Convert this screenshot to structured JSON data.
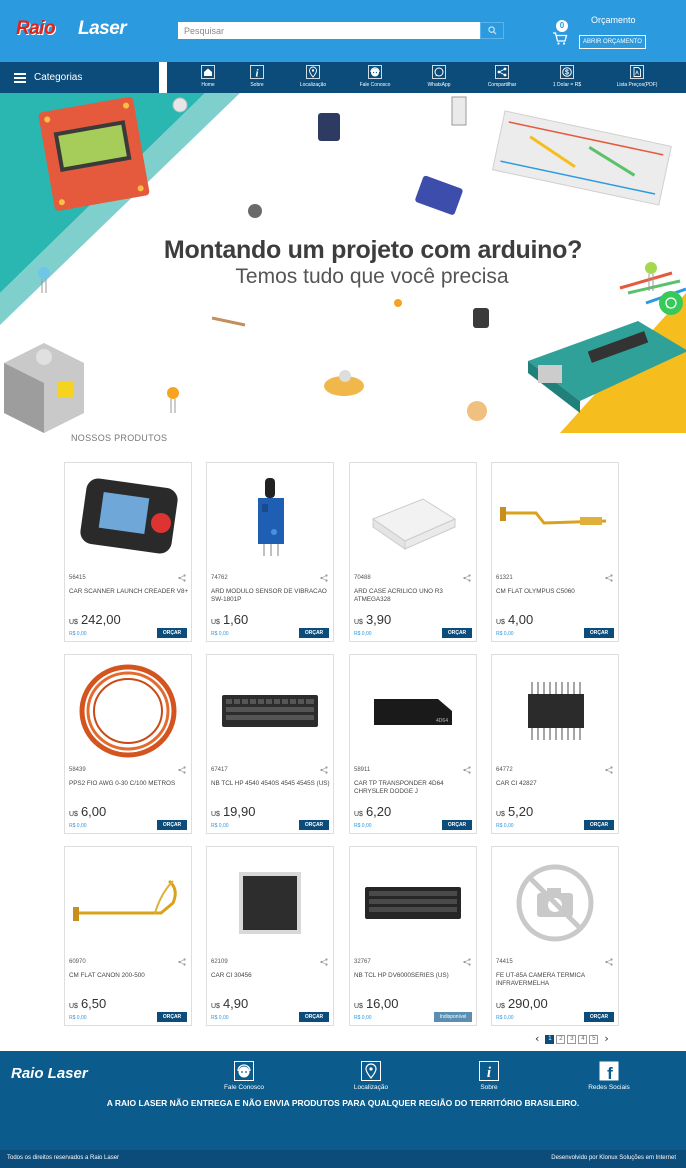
{
  "header": {
    "logo_word1": "Raio",
    "logo_word2": "Laser",
    "search_placeholder": "Pesquisar",
    "cart_count": "0",
    "quote_title": "Orçamento",
    "quote_button": "ABRIR ORÇAMENTO"
  },
  "nav": {
    "categories_label": "Categorias",
    "items": [
      {
        "label": "Home",
        "icon": "home-icon"
      },
      {
        "label": "Sobre",
        "icon": "info-icon"
      },
      {
        "label": "Localização",
        "icon": "location-icon"
      },
      {
        "label": "Fale Conosco",
        "icon": "support-icon"
      },
      {
        "label": "WhatsApp",
        "icon": "whatsapp-icon"
      },
      {
        "label": "Compartilhar",
        "icon": "share-icon"
      },
      {
        "label": "1 Dolar = R$",
        "icon": "dollar-icon"
      },
      {
        "label": "Lista Preços(PDF)",
        "icon": "pdf-icon"
      }
    ]
  },
  "banner": {
    "headline": "Montando um projeto com arduino?",
    "subheadline": "Temos tudo que você precisa"
  },
  "section_title": "NOSSOS PRODUTOS",
  "products": [
    {
      "code": "56415",
      "name": "CAR SCANNER LAUNCH CREADER V8+",
      "currency": "U$",
      "price": "242,00",
      "brl": "R$ 0,00",
      "button": "ORÇAR"
    },
    {
      "code": "74762",
      "name": "ARD MODULO SENSOR DE VIBRACAO SW-1801P",
      "currency": "U$",
      "price": "1,60",
      "brl": "R$ 0,00",
      "button": "ORÇAR"
    },
    {
      "code": "70488",
      "name": "ARD CASE ACRILICO UNO R3 ATMEGA328",
      "currency": "U$",
      "price": "3,90",
      "brl": "R$ 0,00",
      "button": "ORÇAR"
    },
    {
      "code": "61321",
      "name": "CM FLAT OLYMPUS C5060",
      "currency": "U$",
      "price": "4,00",
      "brl": "R$ 0,00",
      "button": "ORÇAR"
    },
    {
      "code": "58439",
      "name": "PPS2 FIO AWG 0-30 C/100 METROS",
      "currency": "U$",
      "price": "6,00",
      "brl": "R$ 0,00",
      "button": "ORÇAR"
    },
    {
      "code": "67417",
      "name": "NB TCL HP 4540 4540S 4545 4545S (US)",
      "currency": "U$",
      "price": "19,90",
      "brl": "R$ 0,00",
      "button": "ORÇAR"
    },
    {
      "code": "58911",
      "name": "CAR TP TRANSPONDER 4D64 CHRYSLER DODGE J",
      "currency": "U$",
      "price": "6,20",
      "brl": "R$ 0,00",
      "button": "ORÇAR"
    },
    {
      "code": "64772",
      "name": "CAR CI 42827",
      "currency": "U$",
      "price": "5,20",
      "brl": "R$ 0,00",
      "button": "ORÇAR"
    },
    {
      "code": "60970",
      "name": "CM FLAT CANON 200-500",
      "currency": "U$",
      "price": "6,50",
      "brl": "R$ 0,00",
      "button": "ORÇAR"
    },
    {
      "code": "62109",
      "name": "CAR CI 30456",
      "currency": "U$",
      "price": "4,90",
      "brl": "R$ 0,00",
      "button": "ORÇAR"
    },
    {
      "code": "32767",
      "name": "NB TCL HP DV6000SERIES (US)",
      "currency": "U$",
      "price": "16,00",
      "brl": "R$ 0,00",
      "button": "Indisponível"
    },
    {
      "code": "74415",
      "name": "FE UT-85A CAMERA TERMICA INFRAVERMELHA",
      "currency": "U$",
      "price": "290,00",
      "brl": "R$ 0,00",
      "button": "ORÇAR"
    }
  ],
  "pagination": {
    "pages": [
      "1",
      "2",
      "3",
      "4",
      "5"
    ],
    "current": "1"
  },
  "footer": {
    "logo": "Raio Laser",
    "items": [
      {
        "label": "Fale Conosco",
        "icon": "support-icon"
      },
      {
        "label": "Localização",
        "icon": "location-icon"
      },
      {
        "label": "Sobre",
        "icon": "info-icon"
      },
      {
        "label": "Redes Sociais",
        "icon": "facebook-icon"
      }
    ],
    "notice": "A RAIO LASER NÃO ENTREGA E NÃO ENVIA PRODUTOS PARA QUALQUER REGIÃO DO TERRITÓRIO BRASILEIRO.",
    "rights": "Todos os direitos reservados a Raio Laser",
    "developer": "Desenvolvido por Klonux Soluções em Internet"
  },
  "colors": {
    "header": "#2b9adf",
    "nav": "#0b4c7a",
    "footer": "#0b5b8c",
    "accent": "#2b9adf",
    "logo_red": "#e2231a"
  }
}
